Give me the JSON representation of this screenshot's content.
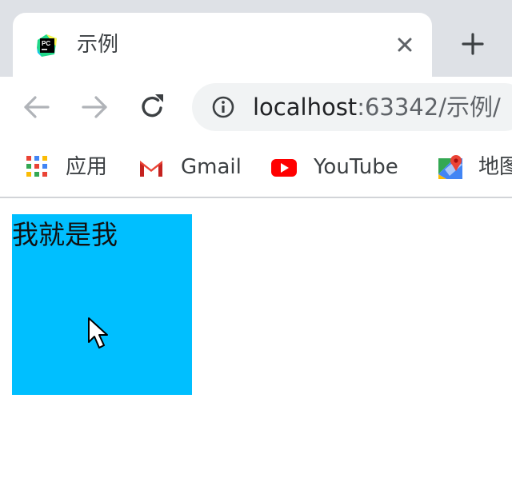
{
  "tab": {
    "title": "示例",
    "favicon": "pycharm-icon"
  },
  "toolbar": {
    "url_host": "localhost",
    "url_rest": ":63342/示例/"
  },
  "bookmarks": {
    "items": [
      {
        "label": "应用",
        "icon": "apps-grid-icon"
      },
      {
        "label": "Gmail",
        "icon": "gmail-icon"
      },
      {
        "label": "YouTube",
        "icon": "youtube-icon"
      },
      {
        "label": "地图",
        "icon": "maps-icon"
      }
    ]
  },
  "page": {
    "box_text": "我就是我",
    "box_color": "#00bfff"
  }
}
